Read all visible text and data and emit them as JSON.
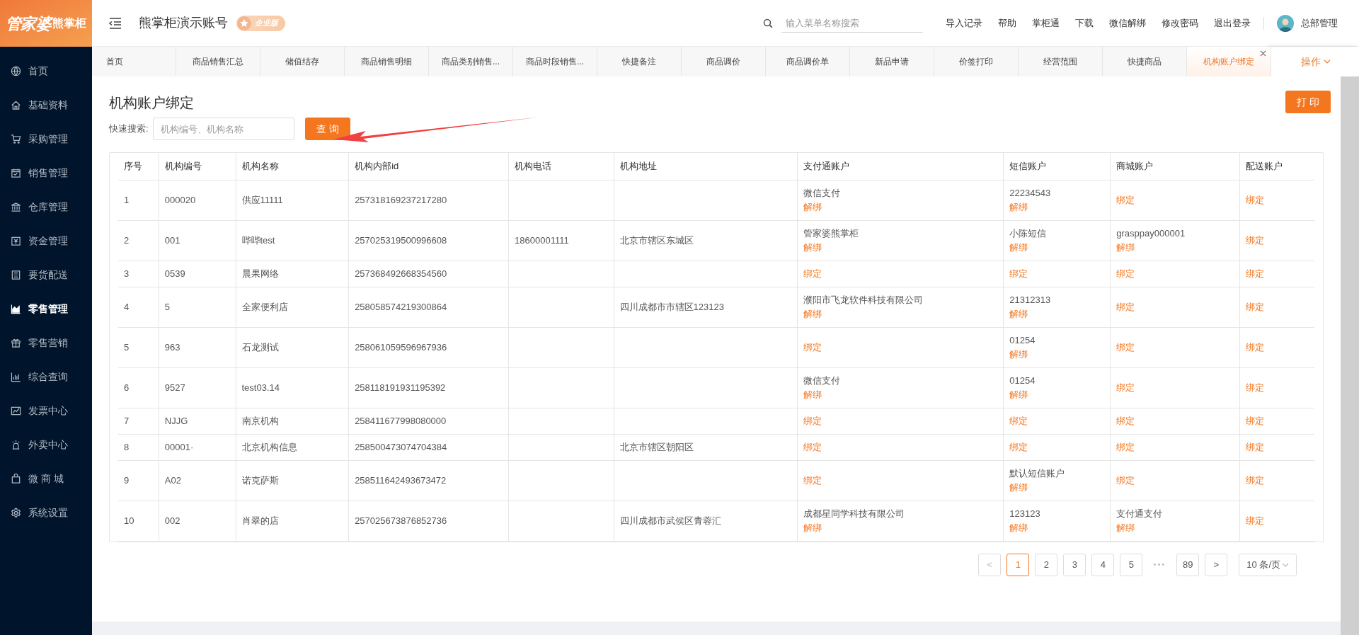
{
  "logo": {
    "brand": "管家婆",
    "product": "熊掌柜"
  },
  "header": {
    "title": "熊掌柜演示账号",
    "badge": "企业版",
    "search": {
      "placeholder": "输入菜单名称搜索"
    },
    "links": [
      "导入记录",
      "帮助",
      "掌柜通",
      "下载",
      "微信解绑",
      "修改密码",
      "退出登录"
    ],
    "user": "总部管理"
  },
  "sidebar": {
    "items": [
      {
        "label": "首页",
        "selected": false
      },
      {
        "label": "基础资料",
        "selected": false
      },
      {
        "label": "采购管理",
        "selected": false
      },
      {
        "label": "销售管理",
        "selected": false
      },
      {
        "label": "仓库管理",
        "selected": false
      },
      {
        "label": "资金管理",
        "selected": false
      },
      {
        "label": "要货配送",
        "selected": false
      },
      {
        "label": "零售管理",
        "selected": true
      },
      {
        "label": "零售营销",
        "selected": false
      },
      {
        "label": "综合查询",
        "selected": false
      },
      {
        "label": "发票中心",
        "selected": false
      },
      {
        "label": "外卖中心",
        "selected": false
      },
      {
        "label": "微 商 城",
        "selected": false
      },
      {
        "label": "系统设置",
        "selected": false
      }
    ]
  },
  "tabs": [
    {
      "label": "首页",
      "selected": false
    },
    {
      "label": "商品销售汇总",
      "selected": false
    },
    {
      "label": "储值结存",
      "selected": false
    },
    {
      "label": "商品销售明细",
      "selected": false
    },
    {
      "label": "商品类别销售...",
      "selected": false
    },
    {
      "label": "商品时段销售...",
      "selected": false
    },
    {
      "label": "快捷备注",
      "selected": false
    },
    {
      "label": "商品调价",
      "selected": false
    },
    {
      "label": "商品调价单",
      "selected": false
    },
    {
      "label": "新品申请",
      "selected": false
    },
    {
      "label": "价签打印",
      "selected": false
    },
    {
      "label": "经营范围",
      "selected": false
    },
    {
      "label": "快捷商品",
      "selected": false
    },
    {
      "label": "机构账户绑定",
      "selected": true
    }
  ],
  "tab_actions": "操作",
  "page": {
    "title": "机构账户绑定",
    "print_button": "打 印",
    "search_label": "快速搜索:",
    "search": {
      "placeholder": "机构编号、机构名称"
    },
    "query_button": "查 询"
  },
  "table": {
    "columns": [
      "序号",
      "机构编号",
      "机构名称",
      "机构内部id",
      "机构电话",
      "机构地址",
      "支付通账户",
      "短信账户",
      "商城账户",
      "配送账户"
    ],
    "rows": [
      {
        "cells": [
          "1",
          "000020",
          "供应11111",
          "257318169237217280",
          "",
          ""
        ],
        "accounts": [
          {
            "value": "微信支付",
            "action": "解绑"
          },
          {
            "value": "22234543",
            "action": "解绑"
          },
          {
            "action": "绑定"
          },
          {
            "action": "绑定"
          }
        ]
      },
      {
        "cells": [
          "2",
          "001",
          "哔哔test",
          "257025319500996608",
          "18600001111",
          "北京市辖区东城区"
        ],
        "accounts": [
          {
            "value": "管家婆熊掌柜",
            "action": "解绑"
          },
          {
            "value": "小陈短信",
            "action": "解绑"
          },
          {
            "value": "grasppay000001",
            "action": "解绑"
          },
          {
            "action": "绑定"
          }
        ]
      },
      {
        "cells": [
          "3",
          "0539",
          "晨果网络",
          "257368492668354560",
          "",
          ""
        ],
        "accounts": [
          {
            "action": "绑定"
          },
          {
            "action": "绑定"
          },
          {
            "action": "绑定"
          },
          {
            "action": "绑定"
          }
        ]
      },
      {
        "cells": [
          "4",
          "5",
          "全家便利店",
          "258058574219300864",
          "",
          "四川成都市市辖区123123"
        ],
        "accounts": [
          {
            "value": "濮阳市飞龙软件科技有限公司",
            "action": "解绑"
          },
          {
            "value": "21312313",
            "action": "解绑"
          },
          {
            "action": "绑定"
          },
          {
            "action": "绑定"
          }
        ]
      },
      {
        "cells": [
          "5",
          "963",
          "石龙测试",
          "258061059596967936",
          "",
          ""
        ],
        "accounts": [
          {
            "action": "绑定"
          },
          {
            "value": "01254",
            "action": "解绑"
          },
          {
            "action": "绑定"
          },
          {
            "action": "绑定"
          }
        ]
      },
      {
        "cells": [
          "6",
          "9527",
          "test03.14",
          "258118191931195392",
          "",
          ""
        ],
        "accounts": [
          {
            "value": "微信支付",
            "action": "解绑"
          },
          {
            "value": "01254",
            "action": "解绑"
          },
          {
            "action": "绑定"
          },
          {
            "action": "绑定"
          }
        ]
      },
      {
        "cells": [
          "7",
          "NJJG",
          "南京机构",
          "258411677998080000",
          "",
          ""
        ],
        "accounts": [
          {
            "action": "绑定"
          },
          {
            "action": "绑定"
          },
          {
            "action": "绑定"
          },
          {
            "action": "绑定"
          }
        ]
      },
      {
        "cells": [
          "8",
          "00001·",
          "北京机构信息",
          "258500473074704384",
          "",
          "北京市辖区朝阳区"
        ],
        "accounts": [
          {
            "action": "绑定"
          },
          {
            "action": "绑定"
          },
          {
            "action": "绑定"
          },
          {
            "action": "绑定"
          }
        ]
      },
      {
        "cells": [
          "9",
          "A02",
          "诺克萨斯",
          "258511642493673472",
          "",
          ""
        ],
        "accounts": [
          {
            "action": "绑定"
          },
          {
            "value": "默认短信账户",
            "action": "解绑"
          },
          {
            "action": "绑定"
          },
          {
            "action": "绑定"
          }
        ]
      },
      {
        "cells": [
          "10",
          "002",
          "肖翠的店",
          "257025673876852736",
          "",
          "四川成都市武侯区青蓉汇"
        ],
        "accounts": [
          {
            "value": "成都星同学科技有限公司",
            "action": "解绑"
          },
          {
            "value": "123123",
            "action": "解绑"
          },
          {
            "value": "支付通支付",
            "action": "解绑"
          },
          {
            "action": "绑定"
          }
        ]
      }
    ]
  },
  "pagination": {
    "prev": "<",
    "pages": [
      {
        "label": "1",
        "selected": true
      },
      {
        "label": "2",
        "selected": false
      },
      {
        "label": "3",
        "selected": false
      },
      {
        "label": "4",
        "selected": false
      },
      {
        "label": "5",
        "selected": false
      }
    ],
    "ellipsis": "•••",
    "last": "89",
    "next": ">",
    "page_size": "10 条/页"
  }
}
